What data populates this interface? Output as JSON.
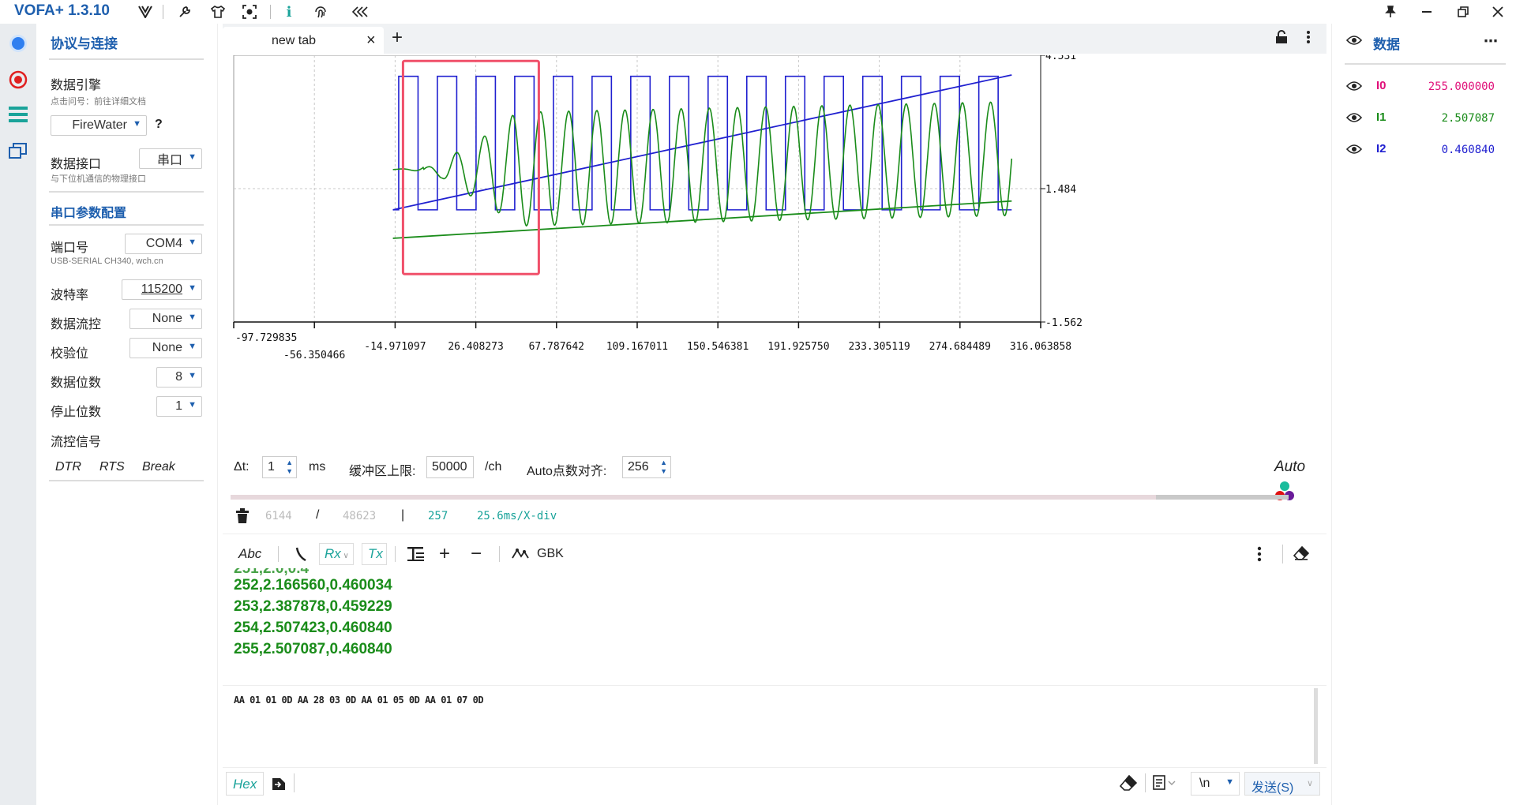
{
  "app": {
    "title": "VOFA+ 1.3.10"
  },
  "protocol": {
    "heading": "协议与连接",
    "engine_label": "数据引擎",
    "engine_hint": "点击问号：前往详细文档",
    "engine_value": "FireWater",
    "engine_help": "?",
    "interface_label": "数据接口",
    "interface_value": "串口",
    "interface_hint": "与下位机通信的物理接口",
    "serial_heading": "串口参数配置",
    "port_label": "端口号",
    "port_value": "COM4",
    "port_hint": "USB-SERIAL CH340, wch.cn",
    "baud_label": "波特率",
    "baud_value": "115200",
    "flow_label": "数据流控",
    "flow_value": "None",
    "parity_label": "校验位",
    "parity_value": "None",
    "databits_label": "数据位数",
    "databits_value": "8",
    "stopbits_label": "停止位数",
    "stopbits_value": "1",
    "signal_label": "流控信号",
    "dtr": "DTR",
    "rts": "RTS",
    "break": "Break"
  },
  "tabs": [
    {
      "label": "new tab",
      "close": "×"
    }
  ],
  "tab_add": "+",
  "chart_data": {
    "type": "line",
    "x_ticks": [
      "-97.729835",
      "-56.350466",
      "-14.971097",
      "26.408273",
      "67.787642",
      "109.167011",
      "150.546381",
      "191.925750",
      "233.305119",
      "274.684489",
      "316.063858"
    ],
    "y_ticks": [
      "4.531",
      "1.484",
      "-1.562"
    ],
    "ylim": [
      -1.562,
      4.531
    ],
    "xlim": [
      -97.729835,
      316.063858
    ],
    "grid": true,
    "series": [
      {
        "name": "I0",
        "color": "#2020d0",
        "description_shape": "square wave + rising ramp",
        "ramp": [
          [
            0,
            0
          ],
          [
            255,
            255
          ]
        ]
      },
      {
        "name": "I1",
        "color": "#1a8c1a",
        "description_shape": "damped-onset sine wave + slow ramp"
      },
      {
        "name": "I2",
        "color": "#1a8c1a"
      }
    ]
  },
  "controls": {
    "dt_label": "Δt:",
    "dt_value": "1",
    "dt_unit": "ms",
    "buffer_label": "缓冲区上限:",
    "buffer_value": "50000",
    "buffer_unit": "/ch",
    "align_label": "Auto点数对齐:",
    "align_value": "256",
    "auto_label": "Auto"
  },
  "status": {
    "count1": "6144",
    "sep1": "/",
    "count2": "48623",
    "sep2": "|",
    "count3": "257",
    "xdiv": "25.6ms/X-div"
  },
  "rx_toolbar": {
    "abc": "Abc",
    "rx": "Rx",
    "tx": "Tx",
    "encoding": "GBK"
  },
  "rx_lines": [
    "252,2.166560,0.460034",
    "253,2.387878,0.459229",
    "254,2.507423,0.460840",
    "255,2.507087,0.460840"
  ],
  "tx_text": "AA 01 01 0D AA 28 03 0D AA 01 05 0D AA 01 07 0D",
  "bottom": {
    "hex": "Hex",
    "newline": "\\n",
    "send": "发送(S)"
  },
  "data_panel": {
    "heading": "数据",
    "channels": [
      {
        "name": "I0",
        "value": "255.000000",
        "color": "#e0107a"
      },
      {
        "name": "I1",
        "value": "2.507087",
        "color": "#1a8c1a"
      },
      {
        "name": "I2",
        "value": "0.460840",
        "color": "#2020d0"
      }
    ]
  }
}
